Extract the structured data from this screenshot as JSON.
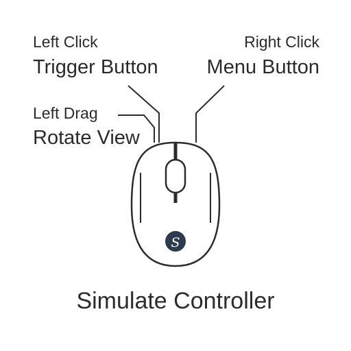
{
  "left_click": {
    "action": "Left Click",
    "function": "Trigger Button"
  },
  "right_click": {
    "action": "Right Click",
    "function": "Menu Button"
  },
  "left_drag": {
    "action": "Left Drag",
    "function": "Rotate View"
  },
  "logo_letter": "S",
  "footer_title": "Simulate Controller",
  "colors": {
    "ink": "#2b2b2b",
    "logo_fill": "#2e3b4e",
    "background": "#ffffff"
  },
  "icons": [
    "mouse-icon",
    "logo-badge-icon"
  ]
}
